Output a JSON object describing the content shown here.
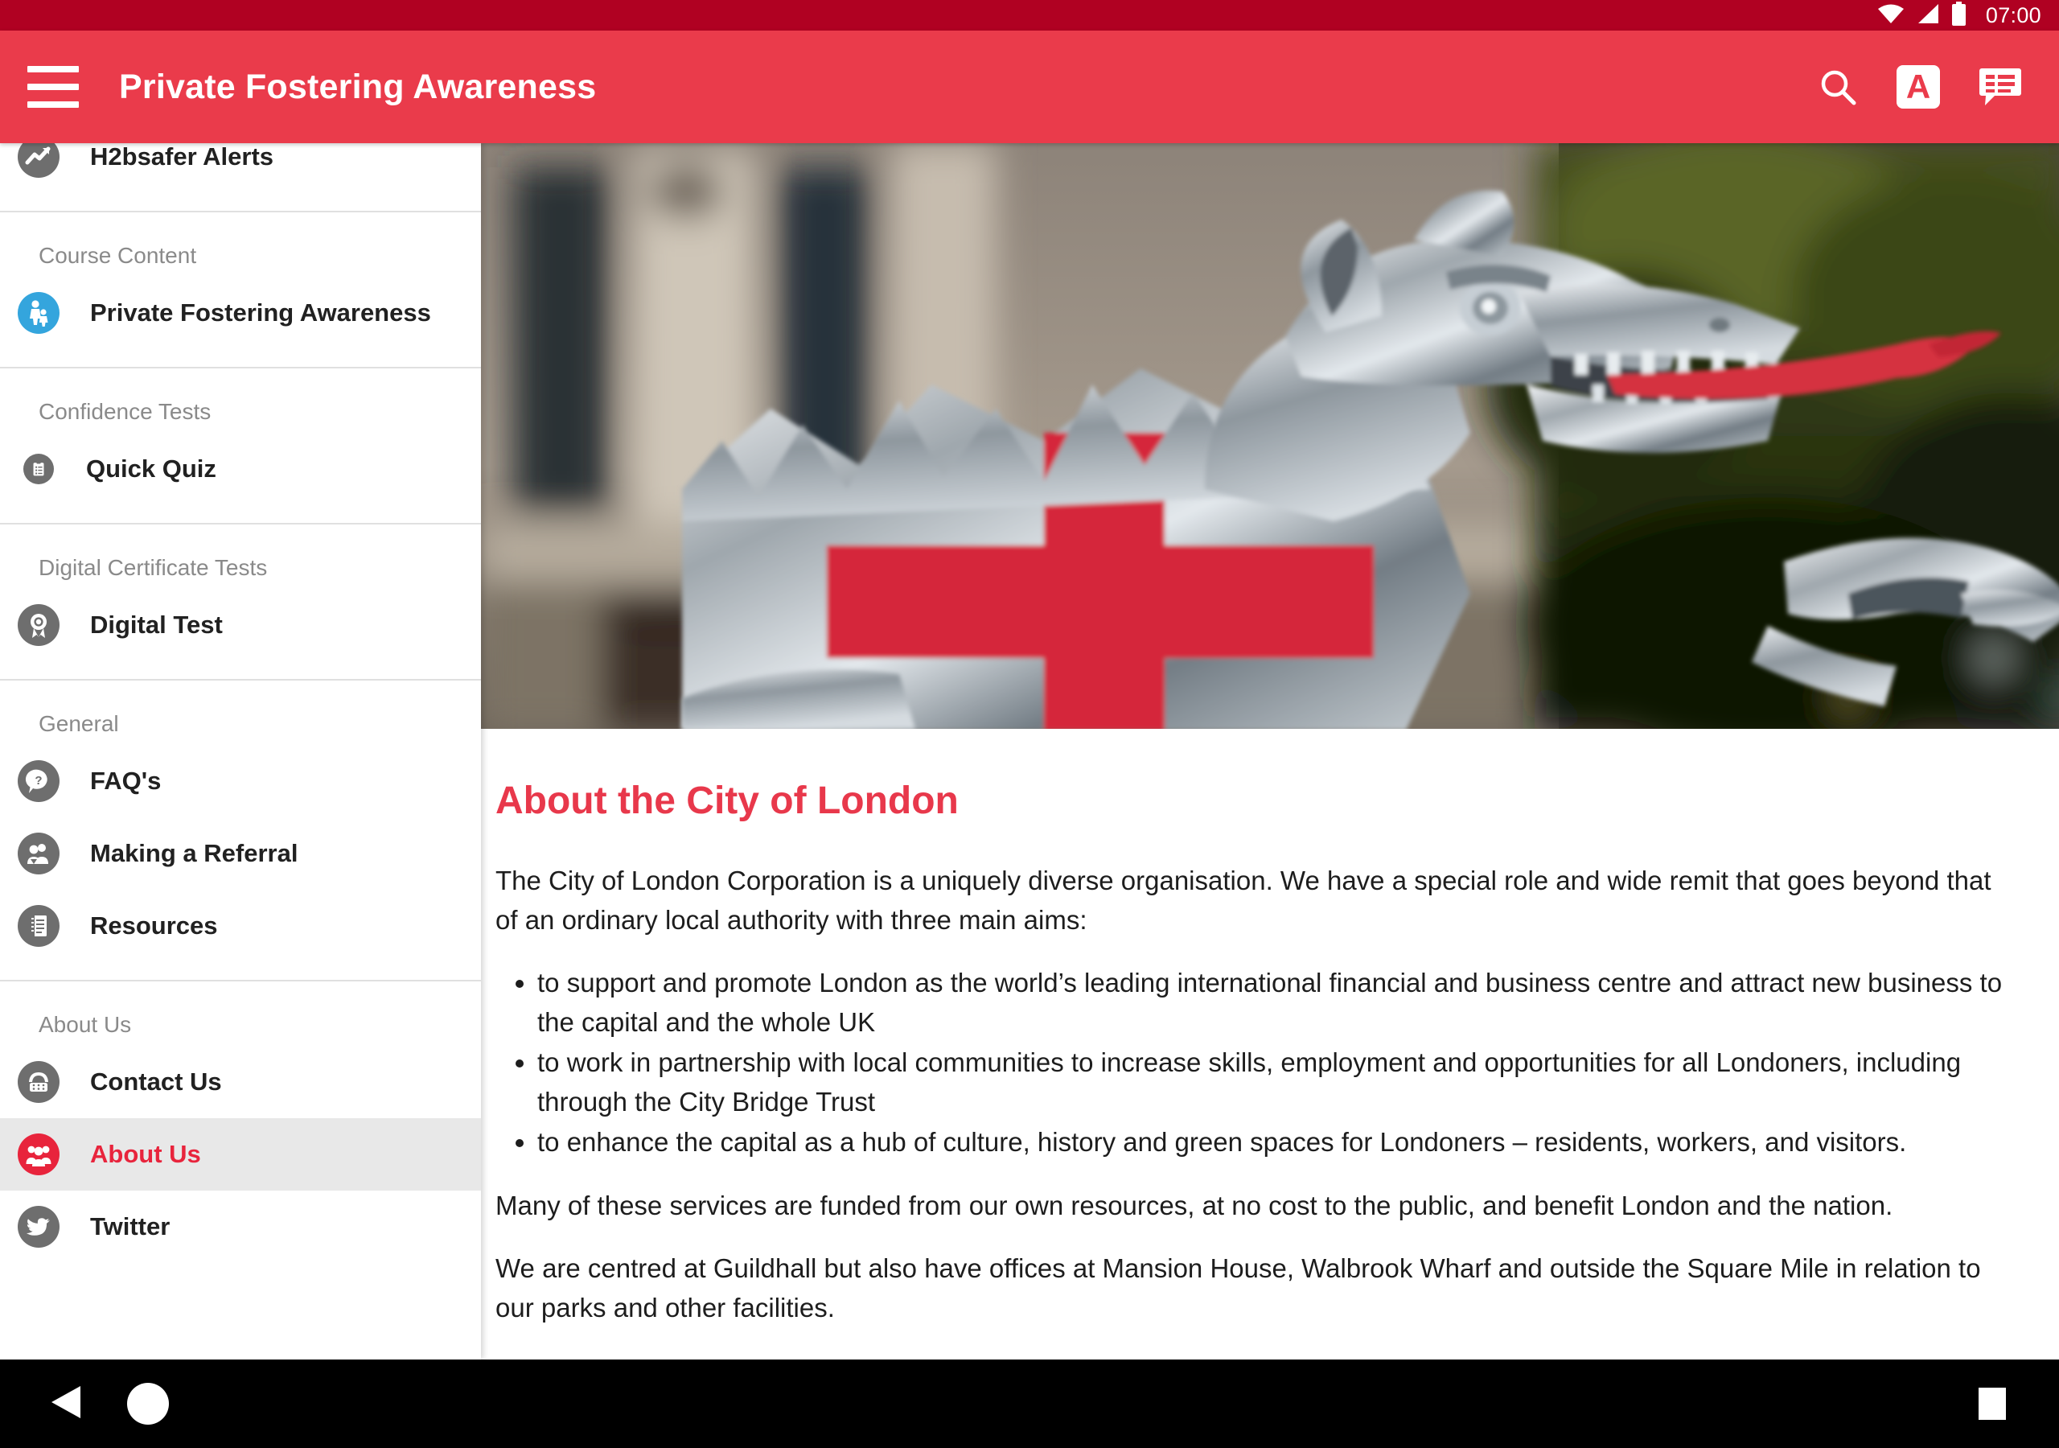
{
  "statusbar": {
    "time": "07:00",
    "icons": [
      "wifi-icon",
      "cell-signal-icon",
      "battery-icon"
    ],
    "background": "#b00122"
  },
  "appbar": {
    "title": "Private Fostering Awareness",
    "background": "#ea3b4b",
    "menu_icon": "hamburger-menu-icon",
    "actions": [
      {
        "name": "search-icon",
        "label": "Search"
      },
      {
        "name": "text-size-icon",
        "label": "A"
      },
      {
        "name": "feedback-icon",
        "label": "Feedback"
      }
    ]
  },
  "sidebar": {
    "groups": [
      {
        "section": null,
        "items": [
          {
            "label": "H2bsafer Alerts",
            "icon": "trending-up-icon",
            "color": "grey",
            "selected": false
          }
        ]
      },
      {
        "section": "Course Content",
        "items": [
          {
            "label": "Private Fostering Awareness",
            "icon": "parent-child-icon",
            "color": "blue",
            "selected": false
          }
        ]
      },
      {
        "section": "Confidence Tests",
        "items": [
          {
            "label": "Quick Quiz",
            "icon": "clipboard-icon",
            "color": "grey-small",
            "selected": false
          }
        ]
      },
      {
        "section": "Digital Certificate Tests",
        "items": [
          {
            "label": "Digital Test",
            "icon": "award-rosette-icon",
            "color": "grey",
            "selected": false
          }
        ]
      },
      {
        "section": "General",
        "items": [
          {
            "label": "FAQ's",
            "icon": "question-bubble-icon",
            "color": "grey",
            "selected": false
          },
          {
            "label": "Making a Referral",
            "icon": "people-referral-icon",
            "color": "grey",
            "selected": false
          },
          {
            "label": "Resources",
            "icon": "notebook-icon",
            "color": "grey",
            "selected": false
          }
        ]
      },
      {
        "section": "About Us",
        "items": [
          {
            "label": "Contact Us",
            "icon": "telephone-icon",
            "color": "grey",
            "selected": false
          },
          {
            "label": "About Us",
            "icon": "group-people-icon",
            "color": "red",
            "selected": true
          },
          {
            "label": "Twitter",
            "icon": "twitter-bird-icon",
            "color": "grey",
            "selected": false
          }
        ]
      }
    ],
    "selected_color": "#e8243c"
  },
  "content": {
    "hero_alt": "City of London dragon statue with red cross shield",
    "title": "About the City of London",
    "title_color": "#e8384b",
    "paragraph_1": "The City of London Corporation is a uniquely diverse organisation. We have a special role and wide remit that goes beyond that of an ordinary local authority with three main aims:",
    "bullets": [
      "to support and promote London as the world’s leading international financial and business centre and attract new business to the capital and the whole UK",
      "to work in partnership with local communities to increase skills, employment and opportunities for all Londoners, including through the City Bridge Trust",
      "to enhance the capital as a hub of culture, history and green spaces for Londoners – residents, workers, and visitors."
    ],
    "paragraph_2": "Many of these services are funded from our own resources, at no cost to the public, and benefit London and the nation.",
    "paragraph_3": "We are centred at Guildhall but also have offices at Mansion House, Walbrook Wharf and outside the Square Mile in relation to our parks and other facilities."
  },
  "navbar": {
    "back": "back-triangle-icon",
    "home": "home-circle-icon",
    "recent": "recent-apps-square-icon"
  }
}
